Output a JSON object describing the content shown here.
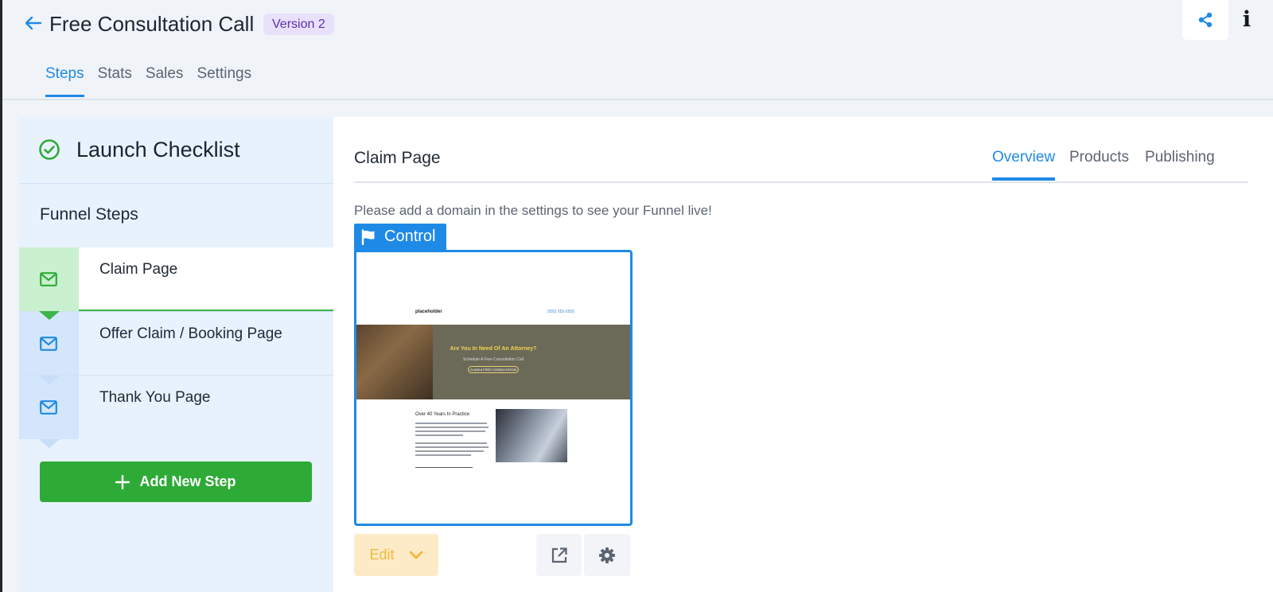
{
  "header": {
    "title": "Free Consultation Call",
    "version_badge": "Version 2",
    "back_icon": "arrow-left-icon",
    "share_icon": "share-icon",
    "info_icon": "info-icon",
    "info_glyph": "i",
    "tabs": [
      {
        "label": "Steps",
        "active": true
      },
      {
        "label": "Stats",
        "active": false
      },
      {
        "label": "Sales",
        "active": false
      },
      {
        "label": "Settings",
        "active": false
      }
    ]
  },
  "sidebar": {
    "checklist_title": "Launch Checklist",
    "funnel_steps_title": "Funnel Steps",
    "steps": [
      {
        "label": "Claim Page",
        "icon": "envelope-icon",
        "active": true
      },
      {
        "label": "Offer Claim / Booking Page",
        "icon": "envelope-icon",
        "active": false
      },
      {
        "label": "Thank You Page",
        "icon": "envelope-icon",
        "active": false
      }
    ],
    "add_step_label": "Add New Step"
  },
  "main": {
    "title": "Claim Page",
    "tabs": [
      {
        "label": "Overview",
        "active": true
      },
      {
        "label": "Products",
        "active": false
      },
      {
        "label": "Publishing",
        "active": false
      }
    ],
    "notice": "Please add a domain in the settings to see your Funnel live!",
    "control_label": "Control",
    "preview": {
      "logo": "placeholder",
      "phone": "(555) 555-5555",
      "hero_title": "Are You In Need Of An Attorney?",
      "hero_subtitle": "Schedule A Free Consultation Call",
      "hero_button": "CLAIM A FREE CONSULTATION",
      "section_title": "Over 40 Years In Practice"
    },
    "edit_label": "Edit"
  },
  "colors": {
    "accent": "#1f8ae6",
    "success": "#2eaa37",
    "badge_bg": "#e9e0fb",
    "badge_text": "#5d2fb2",
    "edit_bg": "#fdebc8",
    "edit_text": "#f2b73a"
  }
}
